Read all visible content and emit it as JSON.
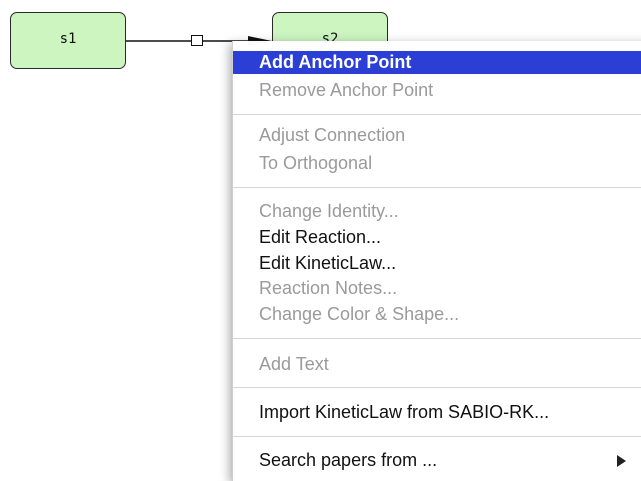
{
  "diagram": {
    "nodes": [
      {
        "id": "s1",
        "label": "s1"
      },
      {
        "id": "s2",
        "label": "s2"
      }
    ],
    "node_fill": "#ccf5c0",
    "node_border": "#2a2a2a"
  },
  "context_menu": {
    "highlight_color": "#2b3fd6",
    "items": [
      {
        "label": "Add Anchor Point",
        "state": "highlighted"
      },
      {
        "label": "Remove Anchor Point",
        "state": "disabled"
      },
      {
        "label": "Adjust Connection",
        "state": "disabled"
      },
      {
        "label": "To Orthogonal",
        "state": "disabled"
      },
      {
        "label": "Change Identity...",
        "state": "disabled"
      },
      {
        "label": "Edit Reaction...",
        "state": "enabled"
      },
      {
        "label": "Edit KineticLaw...",
        "state": "enabled"
      },
      {
        "label": "Reaction Notes...",
        "state": "disabled"
      },
      {
        "label": "Change Color & Shape...",
        "state": "disabled"
      },
      {
        "label": "Add Text",
        "state": "disabled"
      },
      {
        "label": "Import KineticLaw from SABIO-RK...",
        "state": "enabled"
      },
      {
        "label": "Search papers from ...",
        "state": "enabled",
        "submenu": true
      }
    ]
  }
}
